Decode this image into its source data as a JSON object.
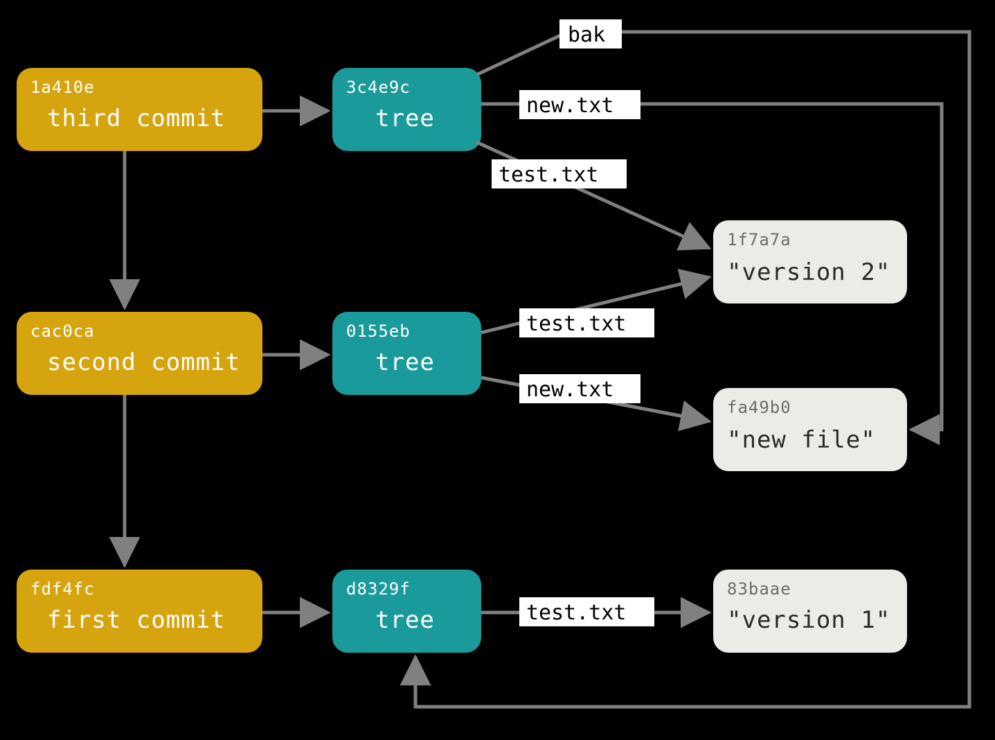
{
  "colors": {
    "commit": "#d6a40f",
    "tree": "#1a9a9a",
    "blob_bg": "#ecece6",
    "edge": "#808080"
  },
  "commits": [
    {
      "hash": "1a410e",
      "label": "third commit"
    },
    {
      "hash": "cac0ca",
      "label": "second commit"
    },
    {
      "hash": "fdf4fc",
      "label": "first commit"
    }
  ],
  "trees": [
    {
      "hash": "3c4e9c",
      "label": "tree"
    },
    {
      "hash": "0155eb",
      "label": "tree"
    },
    {
      "hash": "d8329f",
      "label": "tree"
    }
  ],
  "blobs": [
    {
      "hash": "1f7a7a",
      "label": "\"version 2\""
    },
    {
      "hash": "fa49b0",
      "label": "\"new file\""
    },
    {
      "hash": "83baae",
      "label": "\"version 1\""
    }
  ],
  "edge_labels": {
    "bak": "bak",
    "new_txt": "new.txt",
    "test_txt": "test.txt"
  }
}
